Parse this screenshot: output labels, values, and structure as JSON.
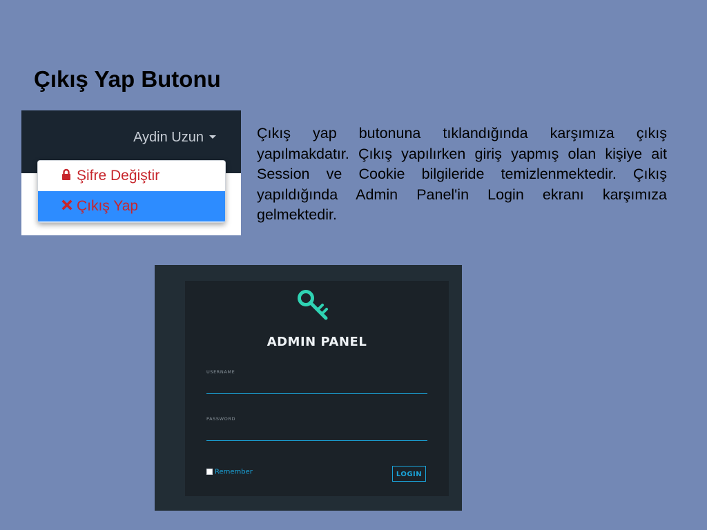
{
  "slide": {
    "title": "Çıkış Yap Butonu",
    "description": "Çıkış yap butonuna tıklandığında karşımıza çıkış yapılmakdatır. Çıkış yapılırken giriş yapmış olan kişiye ait Session ve Cookie bilgileride temizlenmektedir. Çıkış yapıldığında Admin Panel'in Login ekranı karşımıza gelmektedir."
  },
  "dropdown_screenshot": {
    "user_menu_label": "Aydin Uzun",
    "items": [
      {
        "label": "Şifre Değiştir",
        "icon": "lock-icon"
      },
      {
        "label": "Çıkış Yap",
        "icon": "x-icon"
      }
    ],
    "colors": {
      "navbar": "#1a2530",
      "item_text": "#c7262c",
      "highlight": "#2d8cff"
    }
  },
  "login_screenshot": {
    "logo_icon": "key-icon",
    "title": "ADMIN PANEL",
    "username_label": "USERNAME",
    "password_label": "PASSWORD",
    "remember_label": "Remember",
    "login_button": "LOGIN",
    "colors": {
      "background": "#222d35",
      "card": "#1b2228",
      "accent": "#1aa3d9",
      "key": "#2fd3b3"
    }
  }
}
